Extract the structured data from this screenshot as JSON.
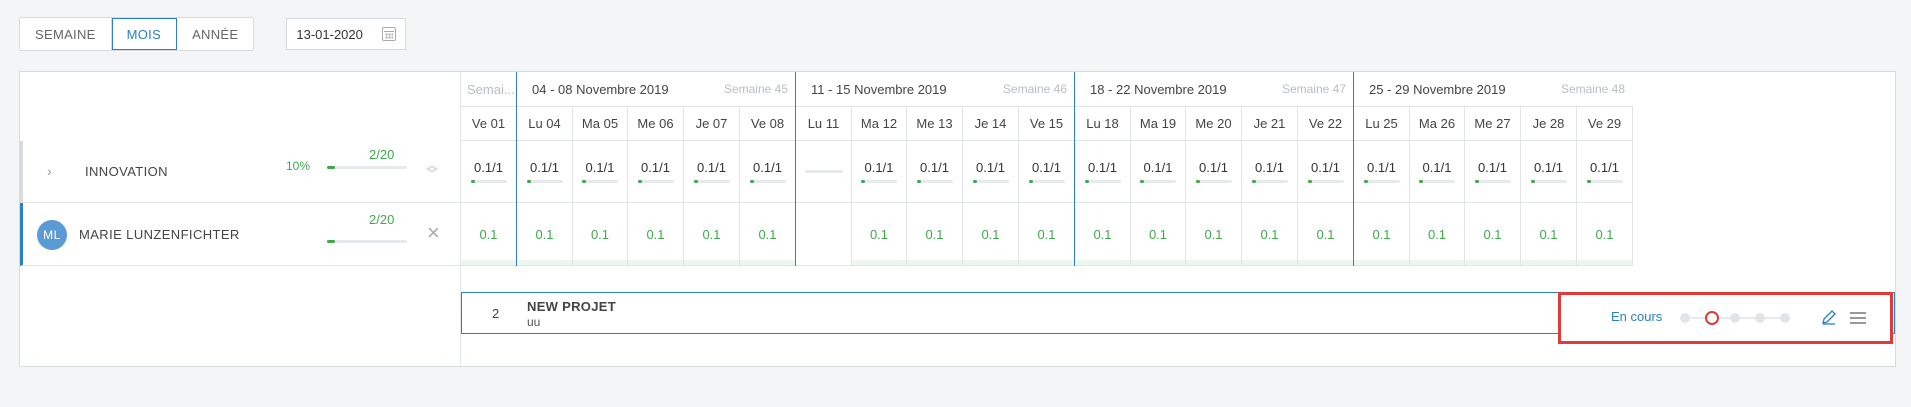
{
  "view_switch": {
    "week": "SEMAINE",
    "month": "MOIS",
    "year": "ANNÉE",
    "active": "month"
  },
  "date_field": {
    "value": "13-01-2020"
  },
  "weeks": [
    {
      "label": "Semai...",
      "num": ""
    },
    {
      "label": "04 - 08 Novembre 2019",
      "num": "Semaine 45"
    },
    {
      "label": "11 - 15 Novembre 2019",
      "num": "Semaine 46"
    },
    {
      "label": "18 - 22 Novembre 2019",
      "num": "Semaine 47"
    },
    {
      "label": "25 - 29 Novembre 2019",
      "num": "Semaine 48"
    }
  ],
  "days": [
    "Ve 01",
    "Lu 04",
    "Ma 05",
    "Me 06",
    "Je 07",
    "Ve 08",
    "Lu 11",
    "Ma 12",
    "Me 13",
    "Je 14",
    "Ve 15",
    "Lu 18",
    "Ma 19",
    "Me 20",
    "Je 21",
    "Ve 22",
    "Lu 25",
    "Ma 26",
    "Me 27",
    "Je 28",
    "Ve 29"
  ],
  "group_row": {
    "label": "INNOVATION",
    "percent": "10%",
    "fraction": "2/20",
    "progress": 0.1,
    "cells": [
      "0.1/1",
      "0.1/1",
      "0.1/1",
      "0.1/1",
      "0.1/1",
      "0.1/1",
      "",
      "0.1/1",
      "0.1/1",
      "0.1/1",
      "0.1/1",
      "0.1/1",
      "0.1/1",
      "0.1/1",
      "0.1/1",
      "0.1/1",
      "0.1/1",
      "0.1/1",
      "0.1/1",
      "0.1/1",
      "0.1/1"
    ]
  },
  "person_row": {
    "initials": "ML",
    "name": "MARIE LUNZENFICHTER",
    "fraction": "2/20",
    "progress": 0.1,
    "cells": [
      "0.1",
      "0.1",
      "0.1",
      "0.1",
      "0.1",
      "0.1",
      "",
      "0.1",
      "0.1",
      "0.1",
      "0.1",
      "0.1",
      "0.1",
      "0.1",
      "0.1",
      "0.1",
      "0.1",
      "0.1",
      "0.1",
      "0.1",
      "0.1"
    ]
  },
  "project": {
    "number": "2",
    "name": "NEW PROJET",
    "subtitle": "uu",
    "status": "En cours",
    "step_count": 5,
    "current_step": 2
  },
  "colors": {
    "accent": "#2b7fc3",
    "green": "#3fa84b",
    "highlight": "#e03b3b"
  }
}
